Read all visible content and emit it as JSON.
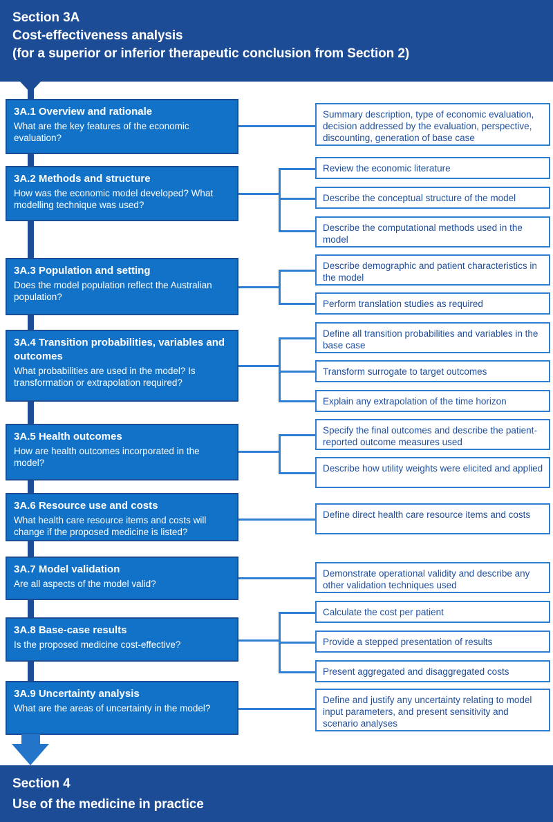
{
  "header": {
    "section_label": "Section 3A",
    "title": "Cost-effectiveness analysis",
    "subtitle": "(for a superior or inferior therapeutic conclusion from Section 2)"
  },
  "footer": {
    "section_label": "Section 4",
    "title": "Use of the medicine in practice"
  },
  "colors": {
    "banner_blue": "#1B4C95",
    "box_blue": "#1172C8",
    "line_blue": "#2E7FD4",
    "text_blue": "#1F4E9C",
    "arrow_blue": "#2275C8",
    "white": "#FFFFFF"
  },
  "subsections": [
    {
      "id": "3A.1",
      "title": "3A.1 Overview and rationale",
      "question": "What are the key features of the economic evaluation?",
      "details": [
        "Summary description, type of economic evaluation, decision addressed by the evaluation, perspective, discounting, generation of base case"
      ]
    },
    {
      "id": "3A.2",
      "title": "3A.2 Methods and structure",
      "question": "How was the economic model developed? What modelling technique was used?",
      "details": [
        "Review the economic literature",
        "Describe the conceptual structure of the model",
        "Describe the computational methods used in the model"
      ]
    },
    {
      "id": "3A.3",
      "title": "3A.3 Population and setting",
      "question": "Does the model population reflect the Australian population?",
      "details": [
        "Describe demographic and patient characteristics in the model",
        "Perform translation studies as required"
      ]
    },
    {
      "id": "3A.4",
      "title": "3A.4 Transition probabilities, variables and outcomes",
      "question": "What probabilities are used in the model? Is transformation or extrapolation required?",
      "details": [
        "Define all transition probabilities and variables in the base case",
        "Transform surrogate to target outcomes",
        "Explain any extrapolation of the time horizon"
      ]
    },
    {
      "id": "3A.5",
      "title": "3A.5 Health outcomes",
      "question": "How are health outcomes incorporated in the model?",
      "details": [
        "Specify the final outcomes and describe the patient-reported outcome measures used",
        "Describe how utility weights were elicited and applied"
      ]
    },
    {
      "id": "3A.6",
      "title": "3A.6 Resource use and costs",
      "question": "What health care resource items and costs will change if the proposed medicine is listed?",
      "details": [
        "Define direct health care resource items and costs"
      ]
    },
    {
      "id": "3A.7",
      "title": "3A.7 Model validation",
      "question": "Are all aspects of the model valid?",
      "details": [
        "Demonstrate operational validity and describe any other validation techniques used"
      ]
    },
    {
      "id": "3A.8",
      "title": "3A.8 Base-case results",
      "question": "Is the proposed medicine cost-effective?",
      "details": [
        "Calculate the cost per patient",
        "Provide a stepped presentation of results",
        "Present aggregated and disaggregated costs"
      ]
    },
    {
      "id": "3A.9",
      "title": "3A.9 Uncertainty analysis",
      "question": "What are the areas of uncertainty in the model?",
      "details": [
        "Define and justify any uncertainty relating to model input parameters, and present sensitivity and scenario analyses"
      ]
    }
  ]
}
